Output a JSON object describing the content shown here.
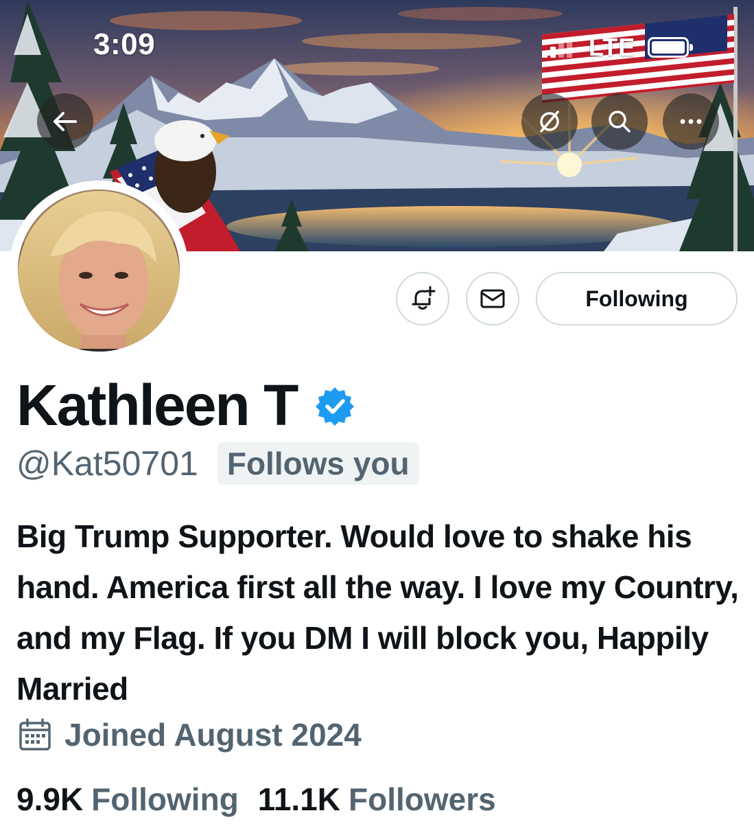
{
  "status_bar": {
    "time": "3:09",
    "network": "LTE"
  },
  "banner": {
    "description_icon_names": [
      "back-arrow-icon",
      "unfollow-circle-icon",
      "search-icon",
      "more-icon"
    ]
  },
  "header_actions": {
    "back_label": "←",
    "more_label": "···"
  },
  "profile": {
    "display_name": "Kathleen T",
    "verified": true,
    "handle": "@Kat50701",
    "follows_you_label": "Follows you",
    "bio": "Big Trump Supporter. Would love to shake his hand. America first all the way. I love my Country, and my Flag. If you DM I will block you, Happily Married",
    "joined": "Joined August 2024",
    "following_count": "9.9K",
    "following_label": "Following",
    "followers_count": "11.1K",
    "followers_label": "Followers"
  },
  "buttons": {
    "following_label": "Following"
  },
  "colors": {
    "text_primary": "#0f1419",
    "text_secondary": "#536471",
    "verified_blue": "#1d9bf0",
    "border": "#cfd9de",
    "chip_bg": "#eff3f4"
  }
}
